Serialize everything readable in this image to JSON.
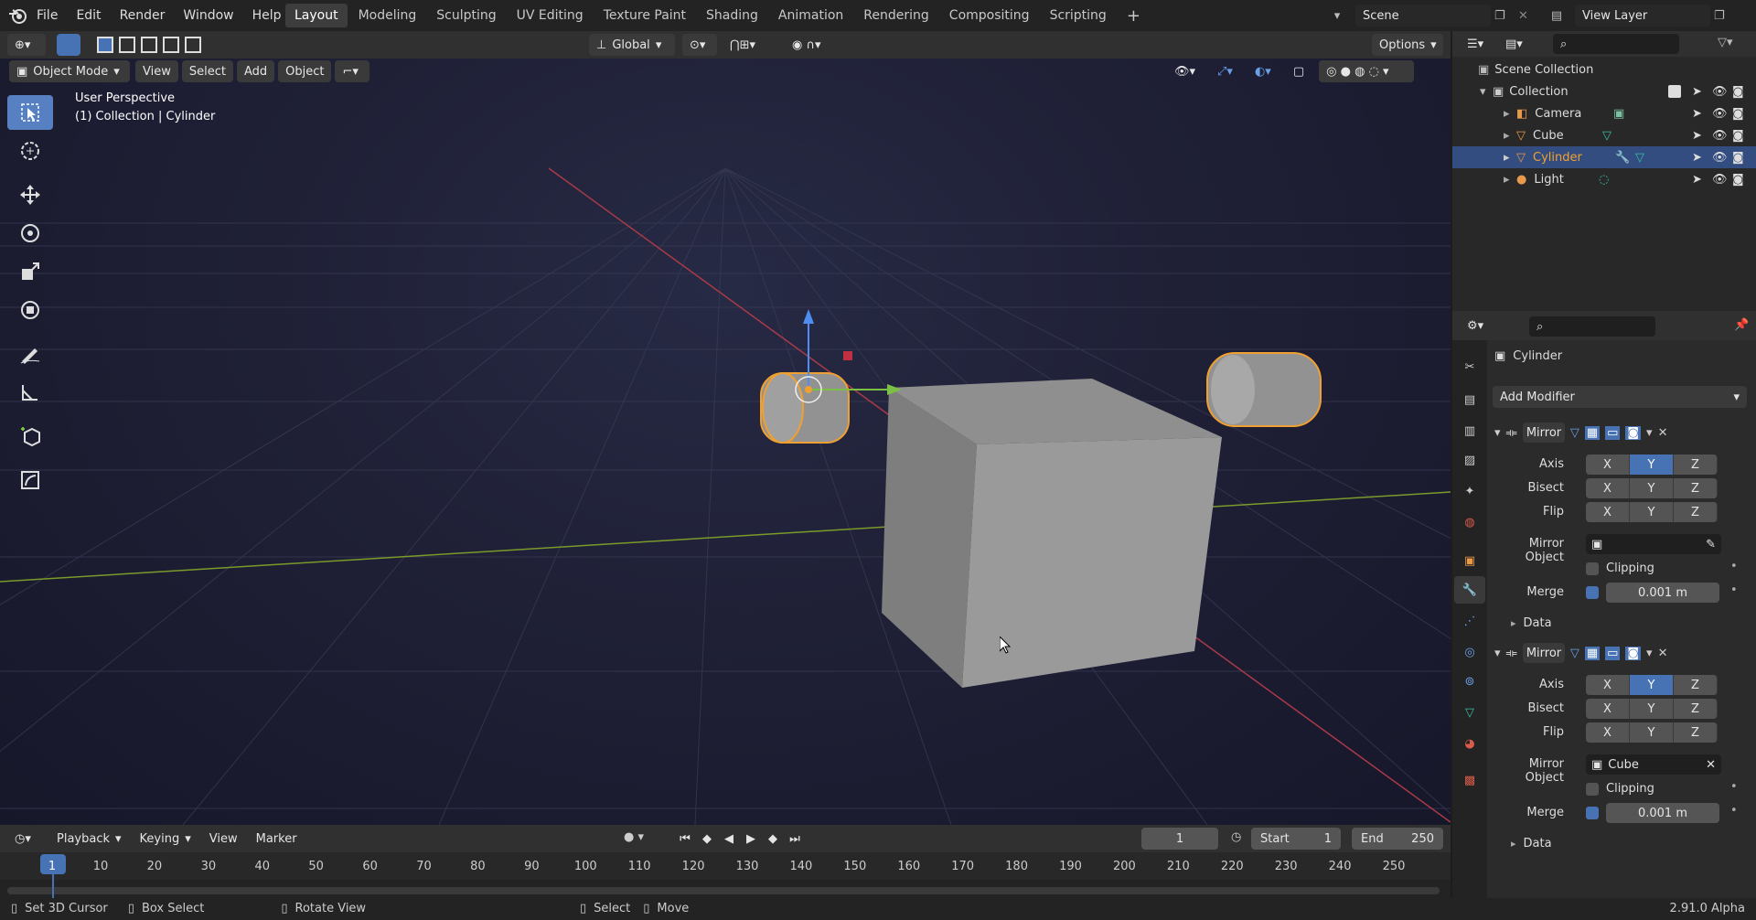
{
  "menus": [
    "File",
    "Edit",
    "Render",
    "Window",
    "Help"
  ],
  "workspaces": [
    "Layout",
    "Modeling",
    "Sculpting",
    "UV Editing",
    "Texture Paint",
    "Shading",
    "Animation",
    "Rendering",
    "Compositing",
    "Scripting"
  ],
  "scene": "Scene",
  "view_layer": "View Layer",
  "viewport": {
    "orientation": "Global",
    "options": "Options",
    "mode": "Object Mode",
    "menus": [
      "View",
      "Select",
      "Add",
      "Object"
    ],
    "perspective": "User Perspective",
    "collection_info": "(1) Collection | Cylinder"
  },
  "outliner": {
    "root": "Scene Collection",
    "collection": "Collection",
    "items": [
      {
        "name": "Camera",
        "selected": false
      },
      {
        "name": "Cube",
        "selected": false
      },
      {
        "name": "Cylinder",
        "selected": true
      },
      {
        "name": "Light",
        "selected": false
      }
    ]
  },
  "properties": {
    "object": "Cylinder",
    "add_modifier": "Add Modifier",
    "modifiers": [
      {
        "name": "Mirror",
        "axis_label": "Axis",
        "bisect_label": "Bisect",
        "flip_label": "Flip",
        "mirror_object_label": "Mirror Object",
        "mirror_object": "",
        "clipping_label": "Clipping",
        "merge_label": "Merge",
        "merge_value": "0.001 m",
        "data_label": "Data",
        "axis": [
          false,
          true,
          false
        ]
      },
      {
        "name": "Mirror",
        "axis_label": "Axis",
        "bisect_label": "Bisect",
        "flip_label": "Flip",
        "mirror_object_label": "Mirror Object",
        "mirror_object": "Cube",
        "clipping_label": "Clipping",
        "merge_label": "Merge",
        "merge_value": "0.001 m",
        "data_label": "Data",
        "axis": [
          false,
          true,
          false
        ]
      }
    ],
    "axes": [
      "X",
      "Y",
      "Z"
    ]
  },
  "timeline": {
    "menus": [
      "Playback",
      "Keying",
      "View",
      "Marker"
    ],
    "current_frame": "1",
    "start_label": "Start",
    "start": "1",
    "end_label": "End",
    "end": "250",
    "ticks": [
      "1",
      "10",
      "20",
      "30",
      "40",
      "50",
      "60",
      "70",
      "80",
      "90",
      "100",
      "110",
      "120",
      "130",
      "140",
      "150",
      "160",
      "170",
      "180",
      "190",
      "200",
      "210",
      "220",
      "230",
      "240",
      "250"
    ]
  },
  "status": {
    "items": [
      "Set 3D Cursor",
      "Box Select",
      "Rotate View",
      "Select",
      "Move"
    ],
    "version": "2.91.0 Alpha"
  },
  "colors": {
    "accent": "#4772b3",
    "selection": "#f0a030",
    "header": "#303030"
  }
}
